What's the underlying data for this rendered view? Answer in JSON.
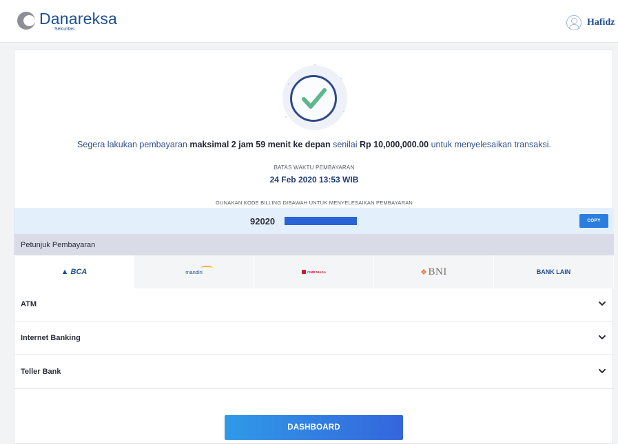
{
  "header": {
    "brand": "Danareksa",
    "brand_sub": "Sekuritas",
    "user_name": "Hafidz"
  },
  "payment": {
    "message_prefix": "Segera lakukan pembayaran ",
    "message_time": "maksimal 2 jam 59 menit ke depan",
    "message_mid": " senilai ",
    "message_amount": "Rp 10,000,000.00",
    "message_suffix": " untuk menyelesaikan transaksi.",
    "deadline_label": "BATAS WAKTU PEMBAYARAN",
    "deadline_value": "24 Feb 2020 13:53 WIB",
    "billing_label": "GUNAKAN KODE BILLING DIBAWAH UNTUK MENYELESAIKAN PEMBAYARAN",
    "billing_code": "92020",
    "copy_label": "COPY"
  },
  "guide": {
    "title": "Petunjuk Pembayaran",
    "banks": [
      {
        "label": "BCA",
        "icon": "bca-logo",
        "active": true
      },
      {
        "label": "mandiri",
        "icon": "mandiri-logo",
        "active": false
      },
      {
        "label": "CIMB NIAGA",
        "icon": "cimb-niaga-logo",
        "active": false
      },
      {
        "label": "BNI",
        "icon": "bni-logo",
        "active": false
      },
      {
        "label": "BANK LAIN",
        "icon": "",
        "active": false
      }
    ],
    "sections": [
      {
        "label": "ATM"
      },
      {
        "label": "Internet Banking"
      },
      {
        "label": "Teller Bank"
      }
    ]
  },
  "actions": {
    "dashboard_label": "DASHBOARD"
  },
  "colors": {
    "brand": "#1d4f91",
    "accent_button": "#2b7de0",
    "check": "#5cb88a"
  }
}
